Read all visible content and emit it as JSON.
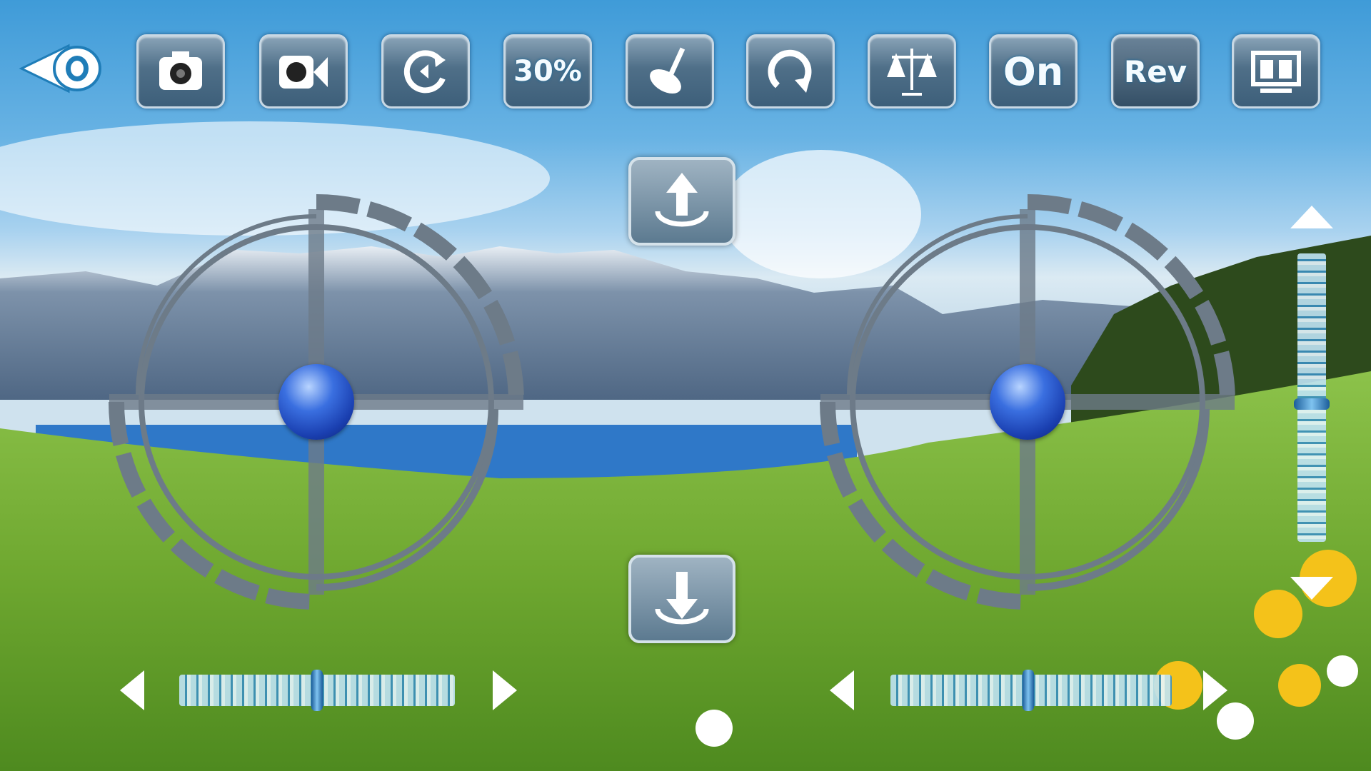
{
  "toolbar": {
    "back": {
      "icon": "back-arrow-icon"
    },
    "buttons": [
      {
        "name": "photo",
        "icon": "camera-icon"
      },
      {
        "name": "video",
        "icon": "video-camera-icon"
      },
      {
        "name": "rotate",
        "icon": "rotate-icon"
      },
      {
        "name": "speed",
        "label": "30%"
      },
      {
        "name": "calibrate",
        "icon": "gyro-calibrate-icon"
      },
      {
        "name": "flip",
        "icon": "flip-icon"
      },
      {
        "name": "trim",
        "icon": "balance-scale-icon"
      },
      {
        "name": "power",
        "label": "On"
      },
      {
        "name": "reverse",
        "label": "Rev"
      },
      {
        "name": "vr",
        "icon": "split-screen-icon"
      }
    ]
  },
  "controls": {
    "takeoff": {
      "icon": "takeoff-arrow-icon"
    },
    "land": {
      "icon": "land-arrow-icon"
    },
    "left_joystick": {
      "x": 0,
      "y": 0
    },
    "right_joystick": {
      "x": 0,
      "y": 0
    },
    "left_trim": {
      "value": 0.5
    },
    "right_trim": {
      "value": 0.5
    },
    "vertical_trim": {
      "value": 0.5
    }
  },
  "colors": {
    "button": "#4f6f88",
    "ring": "#6d7b88",
    "ball": "#2a55c8"
  }
}
